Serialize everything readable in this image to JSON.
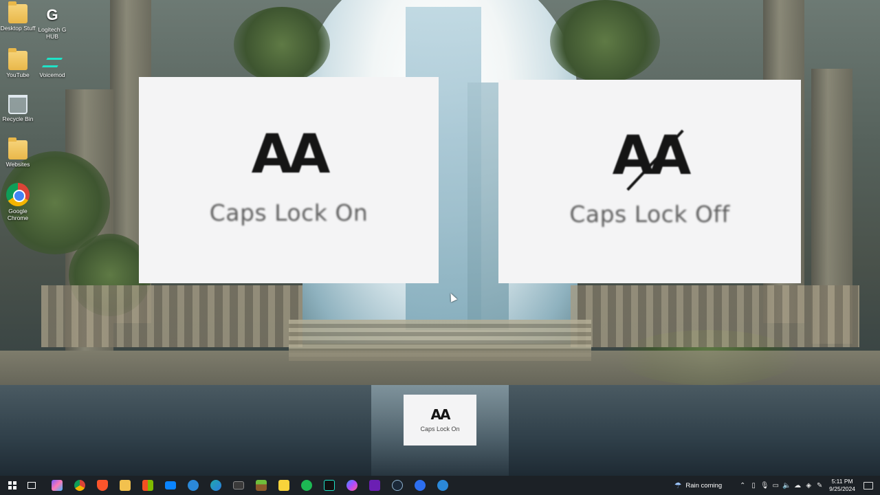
{
  "desktop_icons": [
    {
      "label": "Desktop Stuff",
      "icon": "folder-icon"
    },
    {
      "label": "Logitech G HUB",
      "icon": "logitech-ghub-icon"
    },
    {
      "label": "YouTube",
      "icon": "folder-icon"
    },
    {
      "label": "Voicemod",
      "icon": "voicemod-icon"
    },
    {
      "label": "Recycle Bin",
      "icon": "recycle-bin-icon"
    },
    {
      "label": "Websites",
      "icon": "chrome-folder-icon"
    },
    {
      "label": "Google Chrome",
      "icon": "chrome-icon"
    }
  ],
  "overlays": {
    "caps_on": {
      "glyph": "AA",
      "label": "Caps Lock On"
    },
    "caps_off": {
      "glyph": "AA",
      "label": "Caps Lock Off"
    },
    "toast": {
      "glyph": "AA",
      "label": "Caps Lock On"
    }
  },
  "taskbar": {
    "apps": [
      {
        "name": "copilot",
        "color": "#7b5cff"
      },
      {
        "name": "chrome",
        "color": "#db4437"
      },
      {
        "name": "brave",
        "color": "#fb542b"
      },
      {
        "name": "file-explorer",
        "color": "#f2c14e"
      },
      {
        "name": "microsoft-store",
        "color": "#e8e8e8"
      },
      {
        "name": "mail",
        "color": "#0a84ff"
      },
      {
        "name": "remote-desktop",
        "color": "#2b88d8"
      },
      {
        "name": "edge",
        "color": "#1fa8ad"
      },
      {
        "name": "terminal",
        "color": "#3a3a3a"
      },
      {
        "name": "minecraft",
        "color": "#4c9a2a"
      },
      {
        "name": "sticky-notes",
        "color": "#f8d33b"
      },
      {
        "name": "spotify",
        "color": "#1db954"
      },
      {
        "name": "voicemod",
        "color": "#101010"
      },
      {
        "name": "messenger",
        "color": "#b04cff"
      },
      {
        "name": "next",
        "color": "#6b1fb3"
      },
      {
        "name": "steam",
        "color": "#1b2838"
      },
      {
        "name": "app-blue",
        "color": "#2d6ff0"
      },
      {
        "name": "app-blue-2",
        "color": "#2b88d8"
      }
    ],
    "weather_text": "Rain coming",
    "time": "5:11 PM",
    "date": "9/25/2024"
  }
}
